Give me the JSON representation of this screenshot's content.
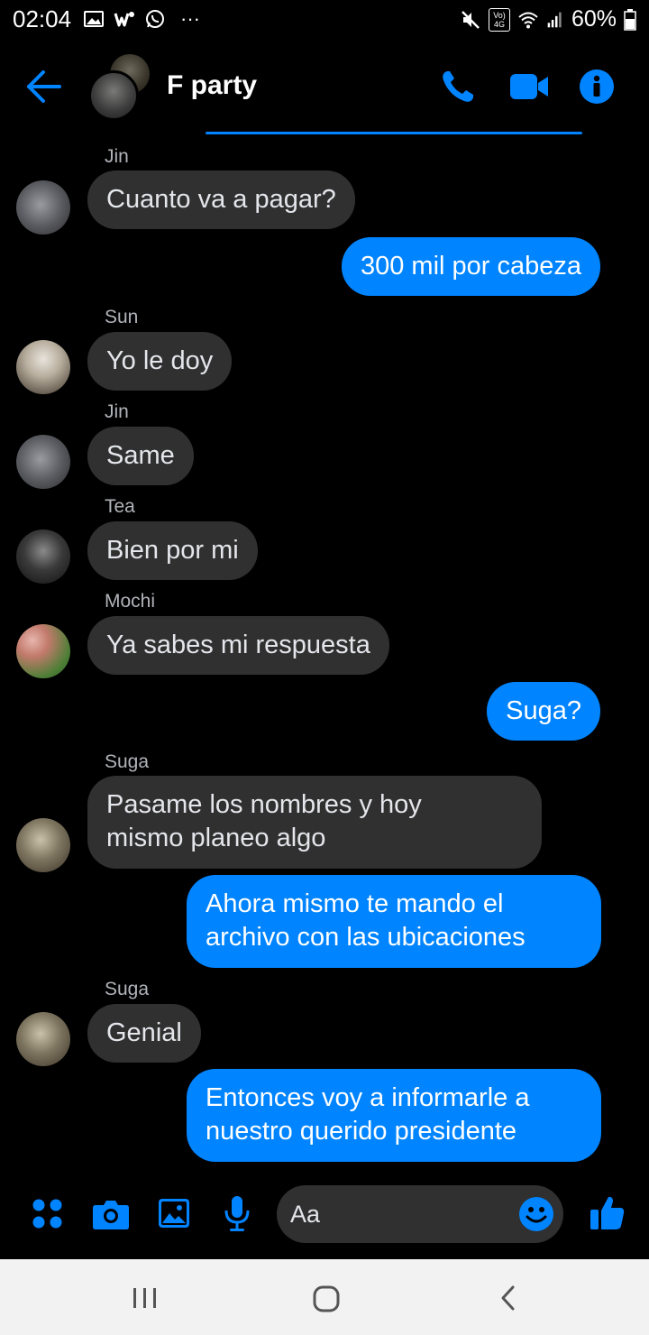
{
  "status_bar": {
    "time": "02:04",
    "battery": "60%",
    "network_badge_top": "Vo)",
    "network_badge_bottom": "4G",
    "overflow": "···"
  },
  "header": {
    "title": "F party"
  },
  "messages": [
    {
      "type": "in",
      "sender": "Jin",
      "text": "Cuanto va a pagar?"
    },
    {
      "type": "out",
      "text": "300 mil por cabeza"
    },
    {
      "type": "in",
      "sender": "Sun",
      "text": "Yo le doy"
    },
    {
      "type": "in",
      "sender": "Jin",
      "text": "Same"
    },
    {
      "type": "in",
      "sender": "Tea",
      "text": "Bien por mi"
    },
    {
      "type": "in",
      "sender": "Mochi",
      "text": "Ya sabes mi respuesta"
    },
    {
      "type": "out",
      "text": "Suga?"
    },
    {
      "type": "in",
      "sender": "Suga",
      "lines": [
        "Pasame los nombres y hoy",
        "mismo planeo algo"
      ]
    },
    {
      "type": "out",
      "lines": [
        "Ahora mismo te mando el",
        "archivo con las ubicaciones"
      ]
    },
    {
      "type": "in",
      "sender": "Suga",
      "text": "Genial"
    },
    {
      "type": "out",
      "lines": [
        "Entonces voy a informarle a",
        "nuestro querido presidente"
      ]
    }
  ],
  "composer": {
    "placeholder": "Aa"
  },
  "icons": {
    "back": "arrow-left-icon",
    "call": "phone-icon",
    "video": "video-camera-icon",
    "info": "info-icon",
    "more": "four-dots-icon",
    "camera": "camera-icon",
    "gallery": "image-icon",
    "mic": "microphone-icon",
    "emoji": "smiley-icon",
    "like": "thumbs-up-icon"
  },
  "colors": {
    "accent": "#0084ff",
    "incoming_bubble": "#303030",
    "background": "#000000"
  }
}
